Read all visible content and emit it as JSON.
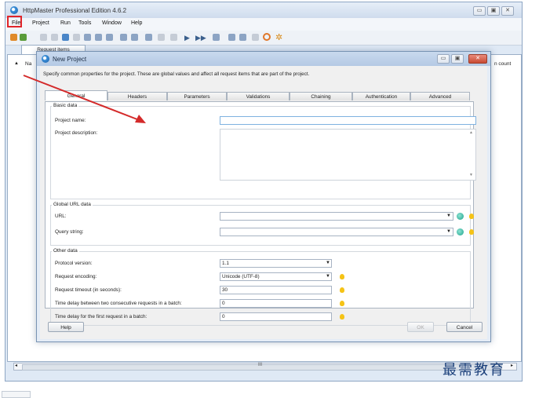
{
  "window": {
    "title": "HttpMaster Professional Edition 4.6.2",
    "controls": [
      "▭",
      "▣",
      "✕"
    ]
  },
  "menu": [
    "File",
    "Project",
    "Run",
    "Tools",
    "Window",
    "Help"
  ],
  "tabs": {
    "request_items": "Request items"
  },
  "grid": {
    "col_name": "Na",
    "col_count": "n count"
  },
  "dialog": {
    "title": "New Project",
    "controls": [
      "▭",
      "▣",
      "✕"
    ],
    "description": "Specify common properties for the project. These are global values and affect all request items that are part of the project.",
    "tabs": [
      "General",
      "Headers",
      "Parameters",
      "Validations",
      "Chaining",
      "Authentication",
      "Advanced"
    ],
    "basic": {
      "title": "Basic data",
      "project_name_label": "Project name:",
      "project_name_value": "",
      "project_desc_label": "Project description:",
      "project_desc_value": ""
    },
    "global": {
      "title": "Global URL data",
      "url_label": "URL:",
      "url_value": "",
      "query_label": "Query string:",
      "query_value": ""
    },
    "other": {
      "title": "Other data",
      "protocol_label": "Protocol version:",
      "protocol_value": "1.1",
      "encoding_label": "Request encoding:",
      "encoding_value": "Unicode (UTF-8)",
      "timeout_label": "Request timeout (in seconds):",
      "timeout_value": "30",
      "delay_batch_label": "Time delay between two consecutive requests in a batch:",
      "delay_batch_value": "0",
      "delay_first_label": "Time delay for the first request in a batch:",
      "delay_first_value": "0"
    },
    "buttons": {
      "help": "Help",
      "ok": "OK",
      "cancel": "Cancel"
    }
  },
  "scroll": {
    "grip": "III"
  },
  "watermark": "最需教育",
  "colors": {
    "highlight": "#e0252a",
    "arrow": "#d42a2a",
    "watermark": "#1a3f7a"
  }
}
